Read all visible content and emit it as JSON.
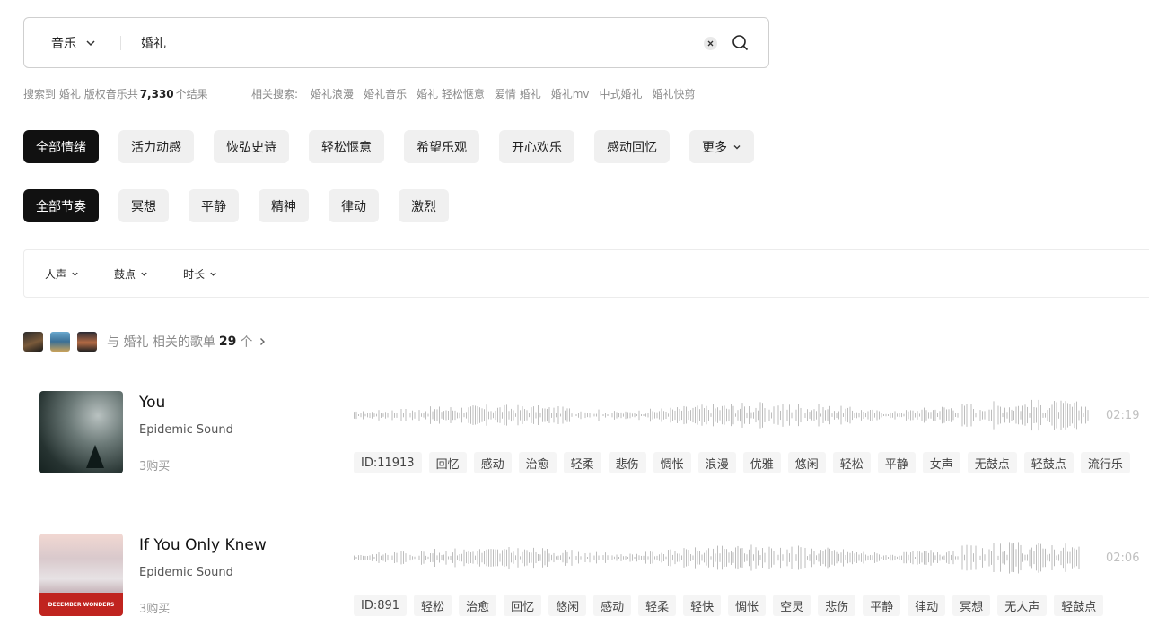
{
  "search": {
    "category": "音乐",
    "query": "婚礼"
  },
  "result": {
    "prefix": "搜索到",
    "keyword": "婚礼",
    "middle": "版权音乐共",
    "count": "7,330",
    "suffix": "个结果"
  },
  "related": {
    "label": "相关搜索:",
    "items": [
      "婚礼浪漫",
      "婚礼音乐",
      "婚礼 轻松惬意",
      "爱情 婚礼",
      "婚礼mv",
      "中式婚礼",
      "婚礼快剪"
    ]
  },
  "moods": {
    "items": [
      "全部情绪",
      "活力动感",
      "恢弘史诗",
      "轻松惬意",
      "希望乐观",
      "开心欢乐",
      "感动回忆"
    ],
    "more": "更多"
  },
  "tempos": {
    "items": [
      "全部节奏",
      "冥想",
      "平静",
      "精神",
      "律动",
      "激烈"
    ]
  },
  "filters": {
    "items": [
      "人声",
      "鼓点",
      "时长"
    ]
  },
  "playlists": {
    "text": "与 婚礼 相关的歌单",
    "count": "29",
    "unit": "个"
  },
  "tracks": [
    {
      "title": "You",
      "artist": "Epidemic Sound",
      "buy": "3购买",
      "duration": "02:19",
      "id": "ID:11913",
      "tags": [
        "回忆",
        "感动",
        "治愈",
        "轻柔",
        "悲伤",
        "惆怅",
        "浪漫",
        "优雅",
        "悠闲",
        "轻松",
        "平静",
        "女声",
        "无鼓点",
        "轻鼓点",
        "流行乐"
      ]
    },
    {
      "title": "If You Only Knew",
      "artist": "Epidemic Sound",
      "buy": "3购买",
      "duration": "02:06",
      "id": "ID:891",
      "tags": [
        "轻松",
        "治愈",
        "回忆",
        "悠闲",
        "感动",
        "轻柔",
        "轻快",
        "惆怅",
        "空灵",
        "悲伤",
        "平静",
        "律动",
        "冥想",
        "无人声",
        "轻鼓点"
      ],
      "cover_text": "DECEMBER WONDERS"
    }
  ]
}
